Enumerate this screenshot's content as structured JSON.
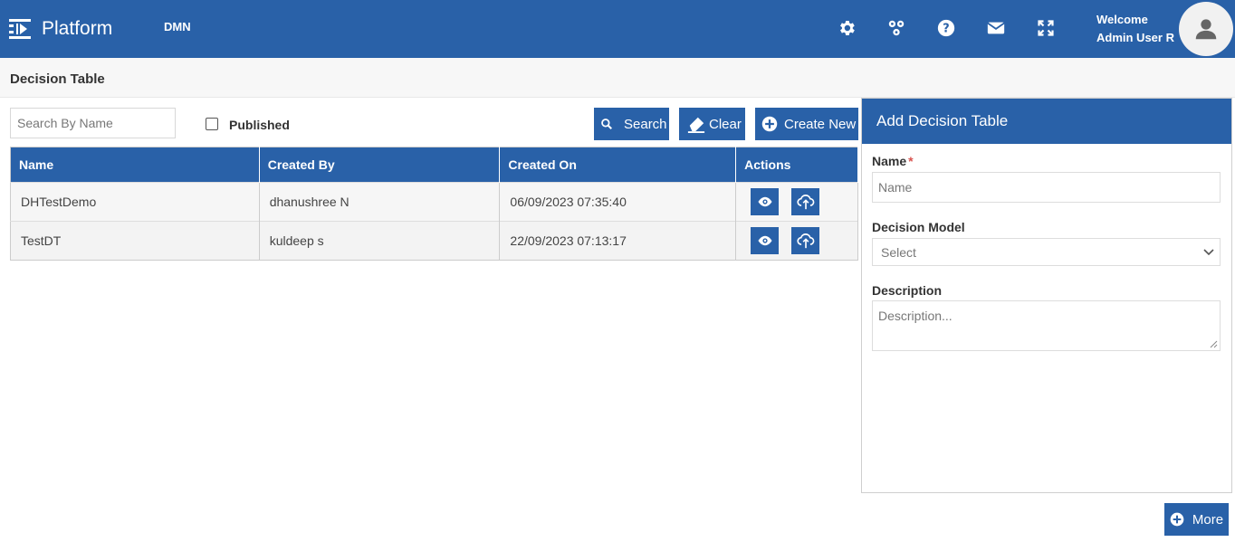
{
  "header": {
    "app_title": "Platform",
    "module": "DMN",
    "welcome": "Welcome",
    "user_name": "Admin User R",
    "icons": [
      "settings-icon",
      "workflow-icon",
      "help-icon",
      "mail-icon",
      "fullscreen-icon"
    ]
  },
  "page": {
    "title": "Decision Table"
  },
  "filters": {
    "search_placeholder": "Search By Name",
    "published_label": "Published",
    "published_checked": false,
    "search_label": "Search",
    "clear_label": "Clear",
    "create_label": "Create New"
  },
  "table": {
    "columns": [
      "Name",
      "Created By",
      "Created On",
      "Actions"
    ],
    "rows": [
      {
        "name": "DHTestDemo",
        "created_by": "dhanushree N",
        "created_on": "06/09/2023 07:35:40"
      },
      {
        "name": "TestDT",
        "created_by": "kuldeep s",
        "created_on": "22/09/2023 07:13:17"
      }
    ],
    "actions": [
      "view-icon",
      "upload-icon"
    ]
  },
  "panel": {
    "title": "Add Decision Table",
    "name_label": "Name",
    "name_required": "*",
    "name_placeholder": "Name",
    "model_label": "Decision Model",
    "model_selected": "Select",
    "description_label": "Description",
    "description_placeholder": "Description..."
  },
  "footer": {
    "more_label": "More"
  },
  "colors": {
    "primary": "#2961a8",
    "required": "#d9534f"
  }
}
